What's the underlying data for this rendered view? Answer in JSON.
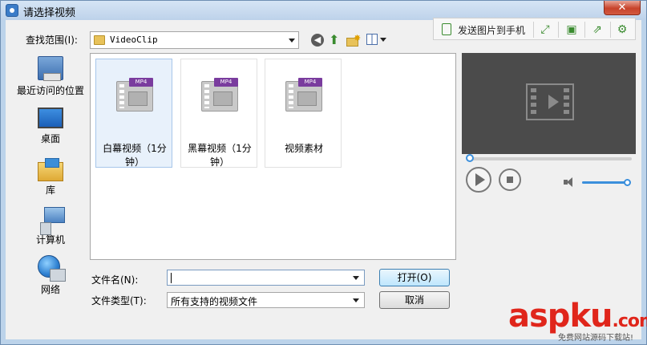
{
  "window": {
    "title": "请选择视频",
    "close_glyph": "✕"
  },
  "lookin": {
    "label": "查找范围(I):",
    "value": "VideoClip"
  },
  "places": [
    {
      "label": "最近访问的位置",
      "icon": "recent-places-icon"
    },
    {
      "label": "桌面",
      "icon": "desktop-icon"
    },
    {
      "label": "库",
      "icon": "libraries-icon"
    },
    {
      "label": "计算机",
      "icon": "computer-icon"
    },
    {
      "label": "网络",
      "icon": "network-icon"
    }
  ],
  "files": [
    {
      "name": "白幕视频（1分钟）",
      "line1": "白幕视频（1分",
      "line2": "钟）",
      "badge": "MP4",
      "selected": true
    },
    {
      "name": "黑幕视频（1分钟）",
      "line1": "黑幕视频（1分",
      "line2": "钟）",
      "badge": "MP4",
      "selected": false
    },
    {
      "name": "视频素材",
      "line1": "视频素材",
      "line2": "",
      "badge": "MP4",
      "selected": false
    }
  ],
  "filename": {
    "label": "文件名(N):",
    "value": ""
  },
  "filetype": {
    "label": "文件类型(T):",
    "value": "所有支持的视频文件"
  },
  "buttons": {
    "open": "打开(O)",
    "cancel": "取消"
  },
  "preview_toolbar": {
    "send_label": "发送图片到手机"
  },
  "player": {
    "progress": 0.02,
    "volume": 0.95
  },
  "watermark": {
    "brand_a": "asp",
    "brand_b": "ku",
    "brand_c": ".com",
    "tagline": "免费网站源码下载站!"
  },
  "colors": {
    "accent": "#3b8fdc",
    "watermark": "#e0261b"
  }
}
